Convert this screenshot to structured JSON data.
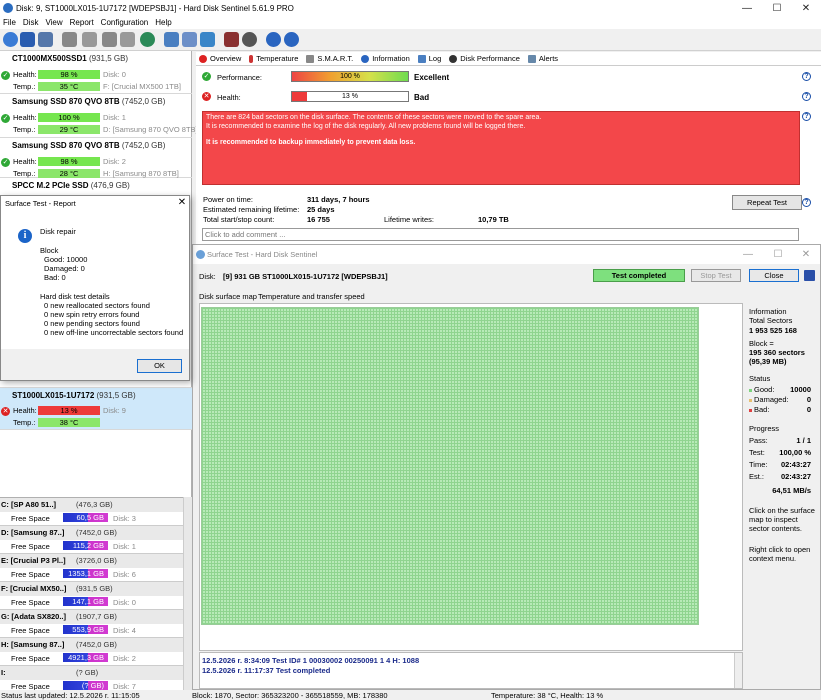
{
  "window": {
    "title": "Disk: 9, ST1000LX015-1U7172 [WDEPSBJ1]  -  Hard Disk Sentinel 5.61.9 PRO"
  },
  "menu": [
    "File",
    "Disk",
    "View",
    "Report",
    "Configuration",
    "Help"
  ],
  "disks": [
    {
      "name": "CT1000MX500SSD1",
      "size": "(931,5 GB)",
      "health": "98 %",
      "temp": "35 °C",
      "disk": "Disk: 0",
      "part": "F: [Crucial MX500 1TB]"
    },
    {
      "name": "Samsung SSD 870 QVO 8TB",
      "size": "(7452,0 GB)",
      "health": "100 %",
      "temp": "29 °C",
      "disk": "Disk: 1",
      "part": "D: [Samsung 870 QVO 8TB]"
    },
    {
      "name": "Samsung SSD 870 QVO 8TB",
      "size": "(7452,0 GB)",
      "health": "98 %",
      "temp": "28 °C",
      "disk": "Disk: 2",
      "part": "H: [Samsung 870 8TB]"
    },
    {
      "name": "SPCC M.2 PCIe SSD",
      "size": "(476,9 GB)"
    },
    {
      "name": "ST1000LX015-1U7172",
      "size": "(931,5 GB)",
      "health": "13 %",
      "temp": "38 °C",
      "disk": "Disk: 9"
    }
  ],
  "labels": {
    "health": "Health:",
    "temp": "Temp.:",
    "free": "Free Space"
  },
  "volumes": [
    {
      "name": "C: [SP A80 51..]",
      "size": "(476,3 GB)",
      "free": "60,5 GB",
      "disk": "Disk: 3"
    },
    {
      "name": "D: [Samsung 87..]",
      "size": "(7452,0 GB)",
      "free": "115,2 GB",
      "disk": "Disk: 1"
    },
    {
      "name": "E: [Crucial P3 Pl..]",
      "size": "(3726,0 GB)",
      "free": "1353,1 GB",
      "disk": "Disk: 6"
    },
    {
      "name": "F: [Crucial MX50..]",
      "size": "(931,5 GB)",
      "free": "147,1 GB",
      "disk": "Disk: 0"
    },
    {
      "name": "G: [Adata SX820..]",
      "size": "(1907,7 GB)",
      "free": "553,9 GB",
      "disk": "Disk: 4"
    },
    {
      "name": "H: [Samsung 87..]",
      "size": "(7452,0 GB)",
      "free": "4921,3 GB",
      "disk": "Disk: 2"
    },
    {
      "name": "I:",
      "size": "(? GB)",
      "free": "(? GB)",
      "disk": "Disk: 7"
    }
  ],
  "status": {
    "left": "Status last updated: 12.5.2026 r. 11:15:05",
    "block": "Block: 1870, Sector: 365323200 - 365518559, MB: 178380",
    "temp": "Temperature: 38  °C,  Health: 13 %"
  },
  "tabs": [
    "Overview",
    "Temperature",
    "S.M.A.R.T.",
    "Information",
    "Log",
    "Disk Performance",
    "Alerts"
  ],
  "overview": {
    "performance_label": "Performance:",
    "performance_value": "100 %",
    "performance_fill": 1.0,
    "performance_status": "Excellent",
    "health_label": "Health:",
    "health_value": "13 %",
    "health_fill": 0.13,
    "health_status": "Bad",
    "alert_lines": [
      "There are 824 bad sectors on the disk surface. The contents of these sectors were moved to the spare area.",
      "It is recommended to examine the log of the disk regularly. All new problems found will be logged there."
    ],
    "alert_bold": "It is recommended to backup immediately to prevent data loss.",
    "power_on_label": "Power on time:",
    "power_on": "311 days, 7 hours",
    "remaining_label": "Estimated remaining lifetime:",
    "remaining": "25 days",
    "startstop_label": "Total start/stop count:",
    "startstop": "16 755",
    "lifetime_label": "Lifetime writes:",
    "lifetime": "10,79 TB",
    "repeat": "Repeat Test",
    "comment": "Click to add comment ..."
  },
  "surface": {
    "title": "Surface Test - Hard Disk Sentinel",
    "disk_label": "Disk:",
    "disk": "[9] 931 GB  ST1000LX015-1U7172 [WDEPSBJ1]",
    "completed": "Test completed",
    "stop": "Stop Test",
    "close": "Close",
    "tab1": "Disk surface map",
    "tab2": "Temperature and transfer speed",
    "info_head": "Information",
    "total_label": "Total Sectors",
    "total": "1 953 525 168",
    "block_label": "Block =",
    "block": "195 360 sectors",
    "block_mb": "(95,39 MB)",
    "status_head": "Status",
    "good_label": "Good:",
    "good": "10000",
    "damaged_label": "Damaged:",
    "damaged": "0",
    "bad_label": "Bad:",
    "bad": "0",
    "progress_head": "Progress",
    "pass_label": "Pass:",
    "pass": "1 / 1",
    "test_label": "Test:",
    "test": "100,00 %",
    "time_label": "Time:",
    "time": "02:43:27",
    "est_label": "Est.:",
    "est": "02:43:27",
    "speed": "64,51 MB/s",
    "hint1": [
      "Click on the surface",
      "map to inspect",
      "sector contents."
    ],
    "hint2": [
      "Right click to open",
      "context menu."
    ],
    "log": [
      "12.5.2026 r.   8:34:09   Test ID# 1 00030002 00250091 1 4 H: 1088",
      "12.5.2026 r.  11:17:37   Test completed"
    ]
  },
  "dialog": {
    "title": "Surface Test - Report",
    "heading": "Disk repair",
    "block": "Block",
    "good": "Good: 10000",
    "damaged": "Damaged: 0",
    "bad": "Bad: 0",
    "details": "Hard disk test details",
    "lines": [
      "0 new reallocated sectors found",
      "0 new spin retry errors found",
      "0 new pending sectors found",
      "0 new off-line uncorrectable sectors found"
    ],
    "ok": "OK"
  },
  "colors": {
    "alert": "#f3474a",
    "good": "#76e64f",
    "bad": "#ee3a3a",
    "map": "#b8eab8"
  }
}
